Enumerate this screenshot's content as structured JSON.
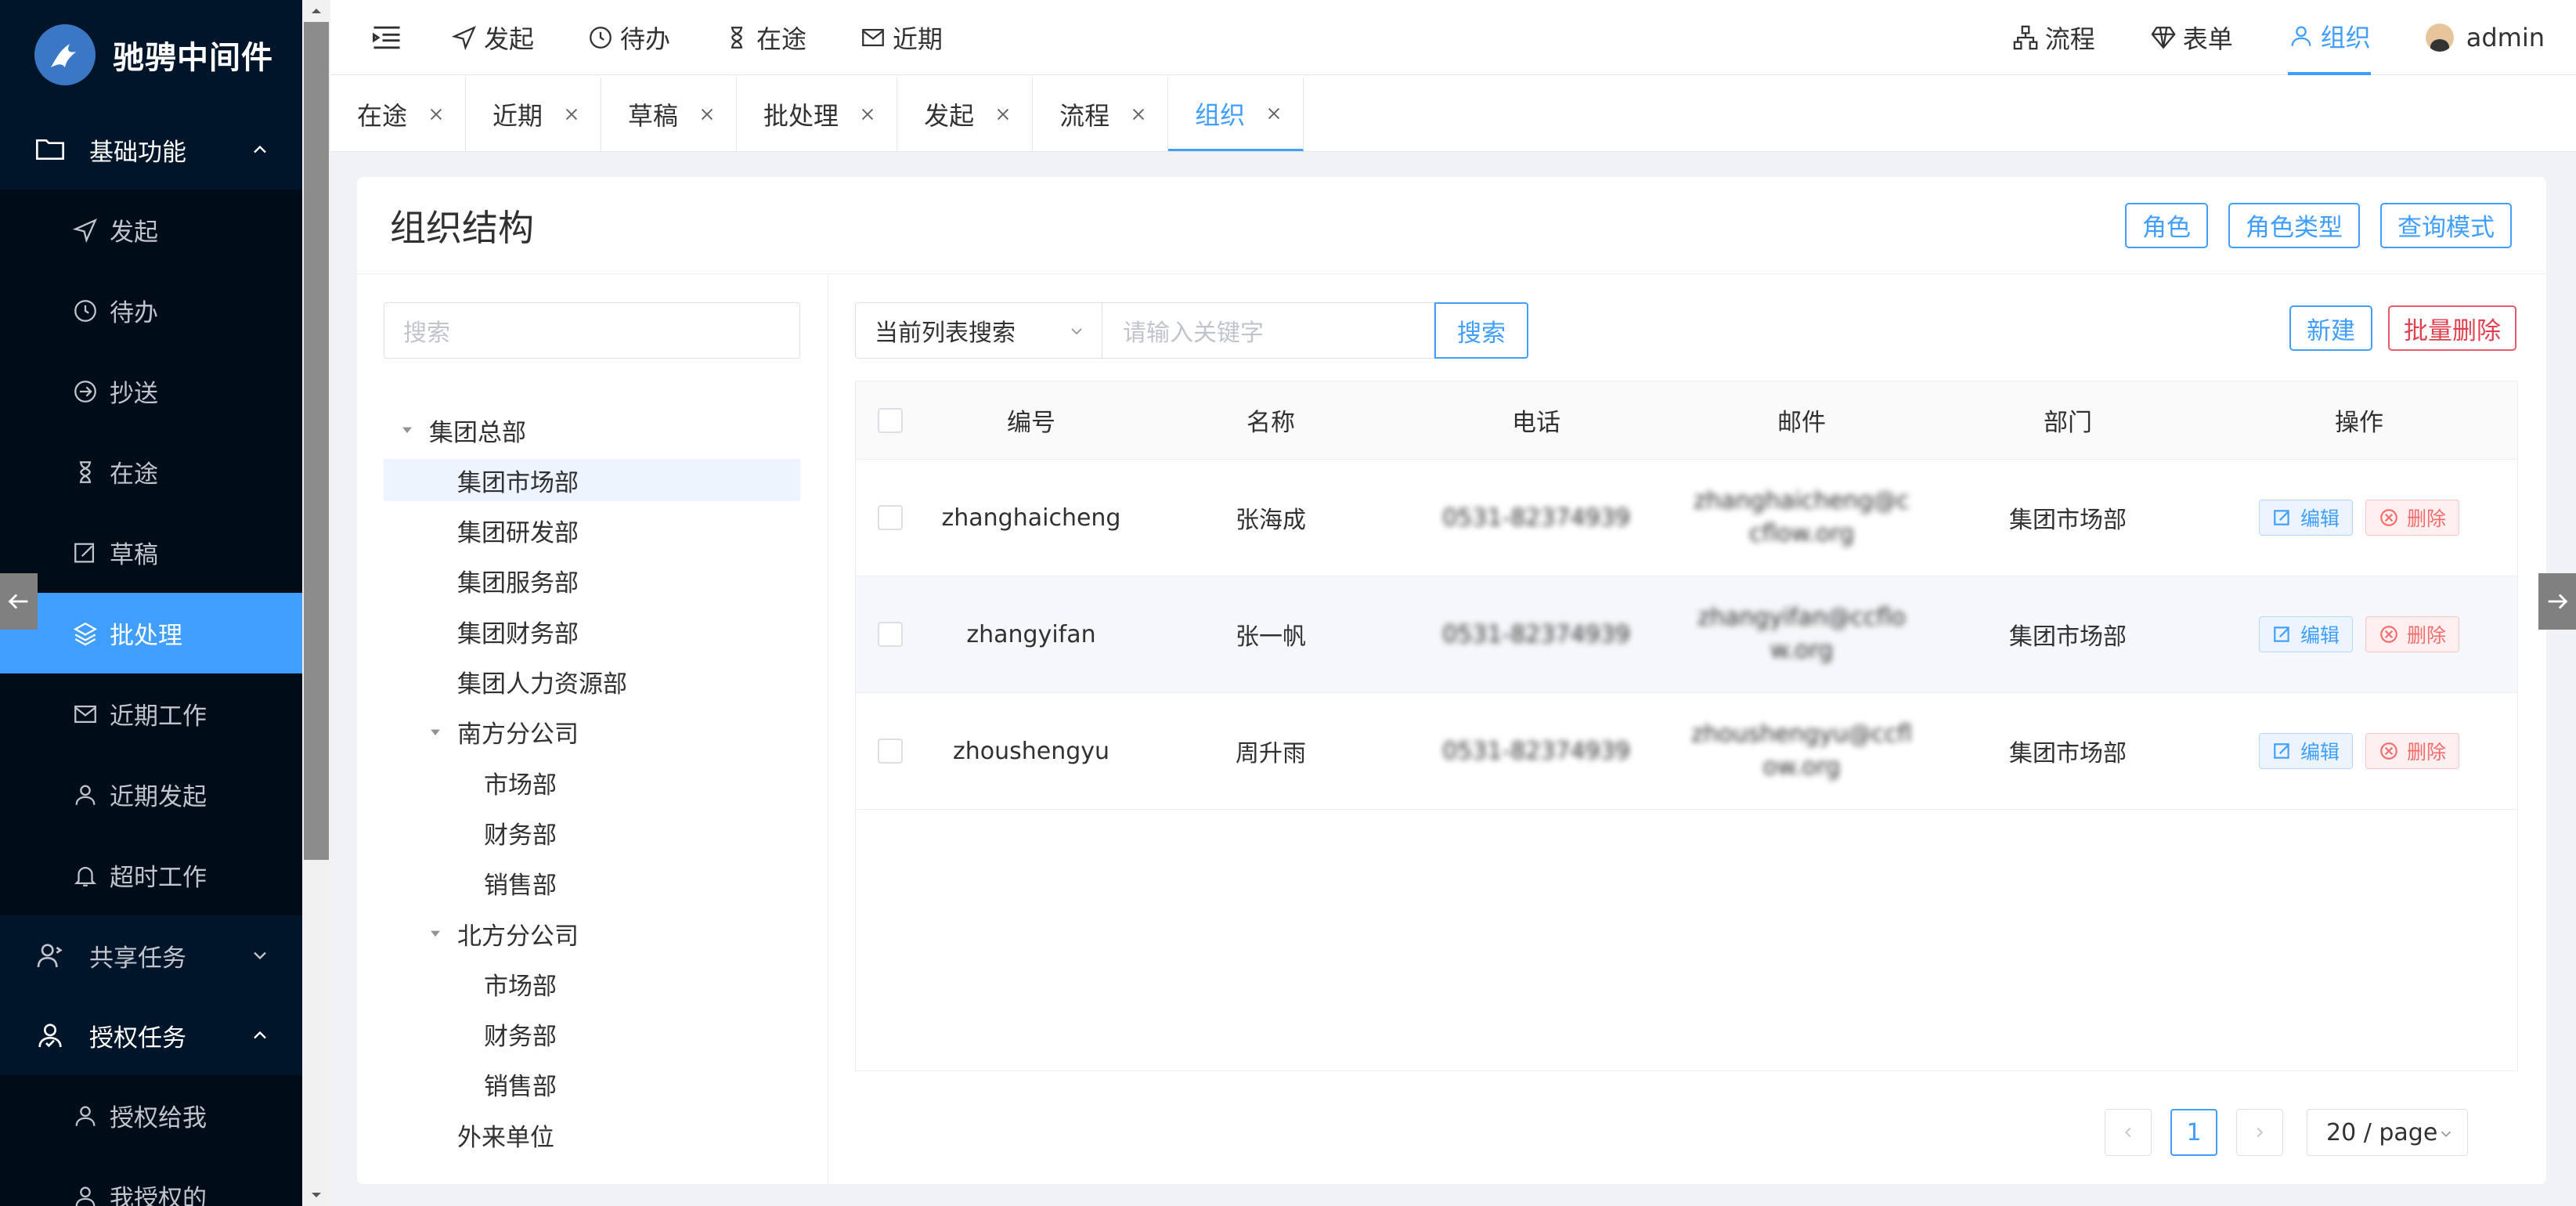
{
  "brand": {
    "name": "驰骋中间件"
  },
  "sidebar": {
    "groups": [
      {
        "label": "基础功能",
        "icon": "folder-icon",
        "expanded": true,
        "items": [
          {
            "label": "发起",
            "icon": "send-icon"
          },
          {
            "label": "待办",
            "icon": "clock-icon"
          },
          {
            "label": "抄送",
            "icon": "forward-icon"
          },
          {
            "label": "在途",
            "icon": "hourglass-icon"
          },
          {
            "label": "草稿",
            "icon": "edit-icon"
          },
          {
            "label": "批处理",
            "icon": "layers-icon",
            "active": true
          },
          {
            "label": "近期工作",
            "icon": "mail-icon"
          },
          {
            "label": "近期发起",
            "icon": "user-icon"
          },
          {
            "label": "超时工作",
            "icon": "bell-icon"
          }
        ]
      },
      {
        "label": "共享任务",
        "icon": "share-user-icon",
        "expanded": false
      },
      {
        "label": "授权任务",
        "icon": "auth-user-icon",
        "expanded": true,
        "items": [
          {
            "label": "授权给我",
            "icon": "user-icon"
          },
          {
            "label": "我授权的",
            "icon": "user-icon"
          }
        ]
      }
    ]
  },
  "topbar": {
    "left": [
      {
        "label": "发起",
        "icon": "send-icon"
      },
      {
        "label": "待办",
        "icon": "clock-icon"
      },
      {
        "label": "在途",
        "icon": "hourglass-icon"
      },
      {
        "label": "近期",
        "icon": "mail-icon"
      }
    ],
    "right": [
      {
        "label": "流程",
        "icon": "flow-icon"
      },
      {
        "label": "表单",
        "icon": "diamond-icon"
      },
      {
        "label": "组织",
        "icon": "user-icon",
        "active": true
      }
    ],
    "user": "admin"
  },
  "tabs": [
    {
      "label": "在途"
    },
    {
      "label": "近期"
    },
    {
      "label": "草稿"
    },
    {
      "label": "批处理"
    },
    {
      "label": "发起"
    },
    {
      "label": "流程"
    },
    {
      "label": "组织",
      "active": true
    }
  ],
  "page": {
    "title": "组织结构",
    "header_buttons": [
      "角色",
      "角色类型",
      "查询模式"
    ]
  },
  "tree": {
    "search_placeholder": "搜索",
    "nodes": [
      {
        "label": "集团总部",
        "level": 0,
        "caret": true
      },
      {
        "label": "集团市场部",
        "level": 1,
        "selected": true
      },
      {
        "label": "集团研发部",
        "level": 1
      },
      {
        "label": "集团服务部",
        "level": 1
      },
      {
        "label": "集团财务部",
        "level": 1
      },
      {
        "label": "集团人力资源部",
        "level": 1
      },
      {
        "label": "南方分公司",
        "level": 1,
        "caret": true
      },
      {
        "label": "市场部",
        "level": 2
      },
      {
        "label": "财务部",
        "level": 2
      },
      {
        "label": "销售部",
        "level": 2
      },
      {
        "label": "北方分公司",
        "level": 1,
        "caret": true
      },
      {
        "label": "市场部",
        "level": 2
      },
      {
        "label": "财务部",
        "level": 2
      },
      {
        "label": "销售部",
        "level": 2
      },
      {
        "label": "外来单位",
        "level": 1
      }
    ]
  },
  "search": {
    "scope": "当前列表搜索",
    "placeholder": "请输入关键字",
    "button": "搜索",
    "new": "新建",
    "batch_delete": "批量删除"
  },
  "table": {
    "columns": [
      "编号",
      "名称",
      "电话",
      "邮件",
      "部门",
      "操作"
    ],
    "rows": [
      {
        "id": "zhanghaicheng",
        "name": "张海成",
        "phone": "0531-82374939",
        "mail": "zhanghaicheng@ccflow.org",
        "dept": "集团市场部"
      },
      {
        "id": "zhangyifan",
        "name": "张一帆",
        "phone": "0531-82374939",
        "mail": "zhangyifan@ccflow.org",
        "dept": "集团市场部"
      },
      {
        "id": "zhoushengyu",
        "name": "周升雨",
        "phone": "0531-82374939",
        "mail": "zhoushengyu@ccflow.org",
        "dept": "集团市场部"
      }
    ],
    "edit_label": "编辑",
    "delete_label": "删除"
  },
  "pagination": {
    "current": "1",
    "page_size": "20 / page"
  },
  "colors": {
    "primary": "#409eff",
    "sidebar": "#001529",
    "danger": "#f56c6c"
  }
}
